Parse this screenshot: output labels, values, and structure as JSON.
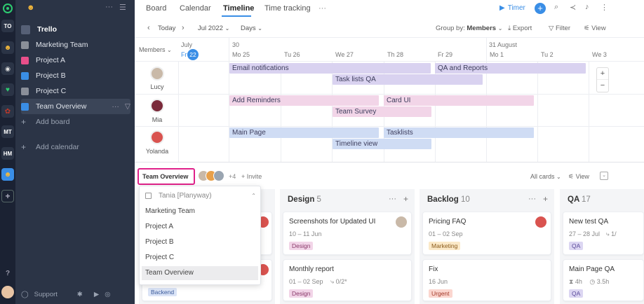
{
  "sidebar": {
    "workspace_title": "Trello",
    "items": [
      {
        "label": "Marketing Team",
        "color": "#8a8f99"
      },
      {
        "label": "Project A",
        "color": "#e94f8a"
      },
      {
        "label": "Project B",
        "color": "#3a8ee6"
      },
      {
        "label": "Project C",
        "color": "#8a8f99"
      },
      {
        "label": "Team Overview",
        "color": "#3a8ee6"
      }
    ],
    "add_board": "Add board",
    "add_calendar": "Add calendar",
    "support": "Support"
  },
  "rail": {
    "items": [
      "TO",
      "MT",
      "HM"
    ]
  },
  "tabs": [
    "Board",
    "Calendar",
    "Timeline",
    "Time tracking"
  ],
  "active_tab": "Timeline",
  "header": {
    "timer": "Timer"
  },
  "toolbar": {
    "today": "Today",
    "month": "Jul 2022",
    "scale": "Days",
    "group_by_label": "Group by:",
    "group_by_value": "Members",
    "export": "Export",
    "filter": "Filter",
    "view": "View"
  },
  "timeline": {
    "members_header": "Members",
    "month_july": "July",
    "month_30": "30",
    "month_august": "31 August",
    "days": [
      "Fr",
      "22",
      "Mo 25",
      "Tu 26",
      "We 27",
      "Th 28",
      "Fr 29",
      "Mo 1",
      "Tu 2",
      "We 3"
    ],
    "members": [
      "Lucy",
      "Mia",
      "Yolanda"
    ],
    "tasks": [
      "Email notifications",
      "QA and Reports",
      "Task lists QA",
      "Add Reminders",
      "Card UI",
      "Team Survey",
      "Main Page",
      "Tasklists",
      "Timeline view"
    ]
  },
  "board": {
    "selector": "Team Overview",
    "extra_members": "+4",
    "invite": "+ Invite",
    "all_cards": "All cards",
    "view": "View",
    "columns": [
      {
        "title": "Design",
        "count": "5"
      },
      {
        "title": "Backlog",
        "count": "10"
      },
      {
        "title": "QA",
        "count": "17"
      }
    ],
    "cards": {
      "c1_tag": "Backend",
      "d1_title": "Screenshots for Updated UI",
      "d1_date": "10 – 11 Jun",
      "d1_tag": "Design",
      "d2_title": "Monthly report",
      "d2_date": "01 – 02 Sep",
      "d2_sub": "0/2*",
      "d2_tag": "Design",
      "b1_title": "Pricing FAQ",
      "b1_date": "01 – 02 Sep",
      "b1_tag": "Marketing",
      "b2_title": "Fix",
      "b2_date": "16 Jun",
      "b2_tag": "Urgent",
      "q1_title": "New test QA",
      "q1_date": "27 – 28 Jul",
      "q1_sub": "1/",
      "q1_tag": "QA",
      "q2_title": "Main Page QA",
      "q2_time1": "4h",
      "q2_time2": "3.5h",
      "q2_tag": "QA"
    }
  },
  "dropdown": {
    "header": "Tania [Planyway)",
    "items": [
      "Marketing Team",
      "Project A",
      "Project B",
      "Project C",
      "Team Overview"
    ]
  },
  "colors": {
    "accent": "#3a8ee6",
    "highlight_border": "#e0218a",
    "today": "#3a8ee6"
  }
}
